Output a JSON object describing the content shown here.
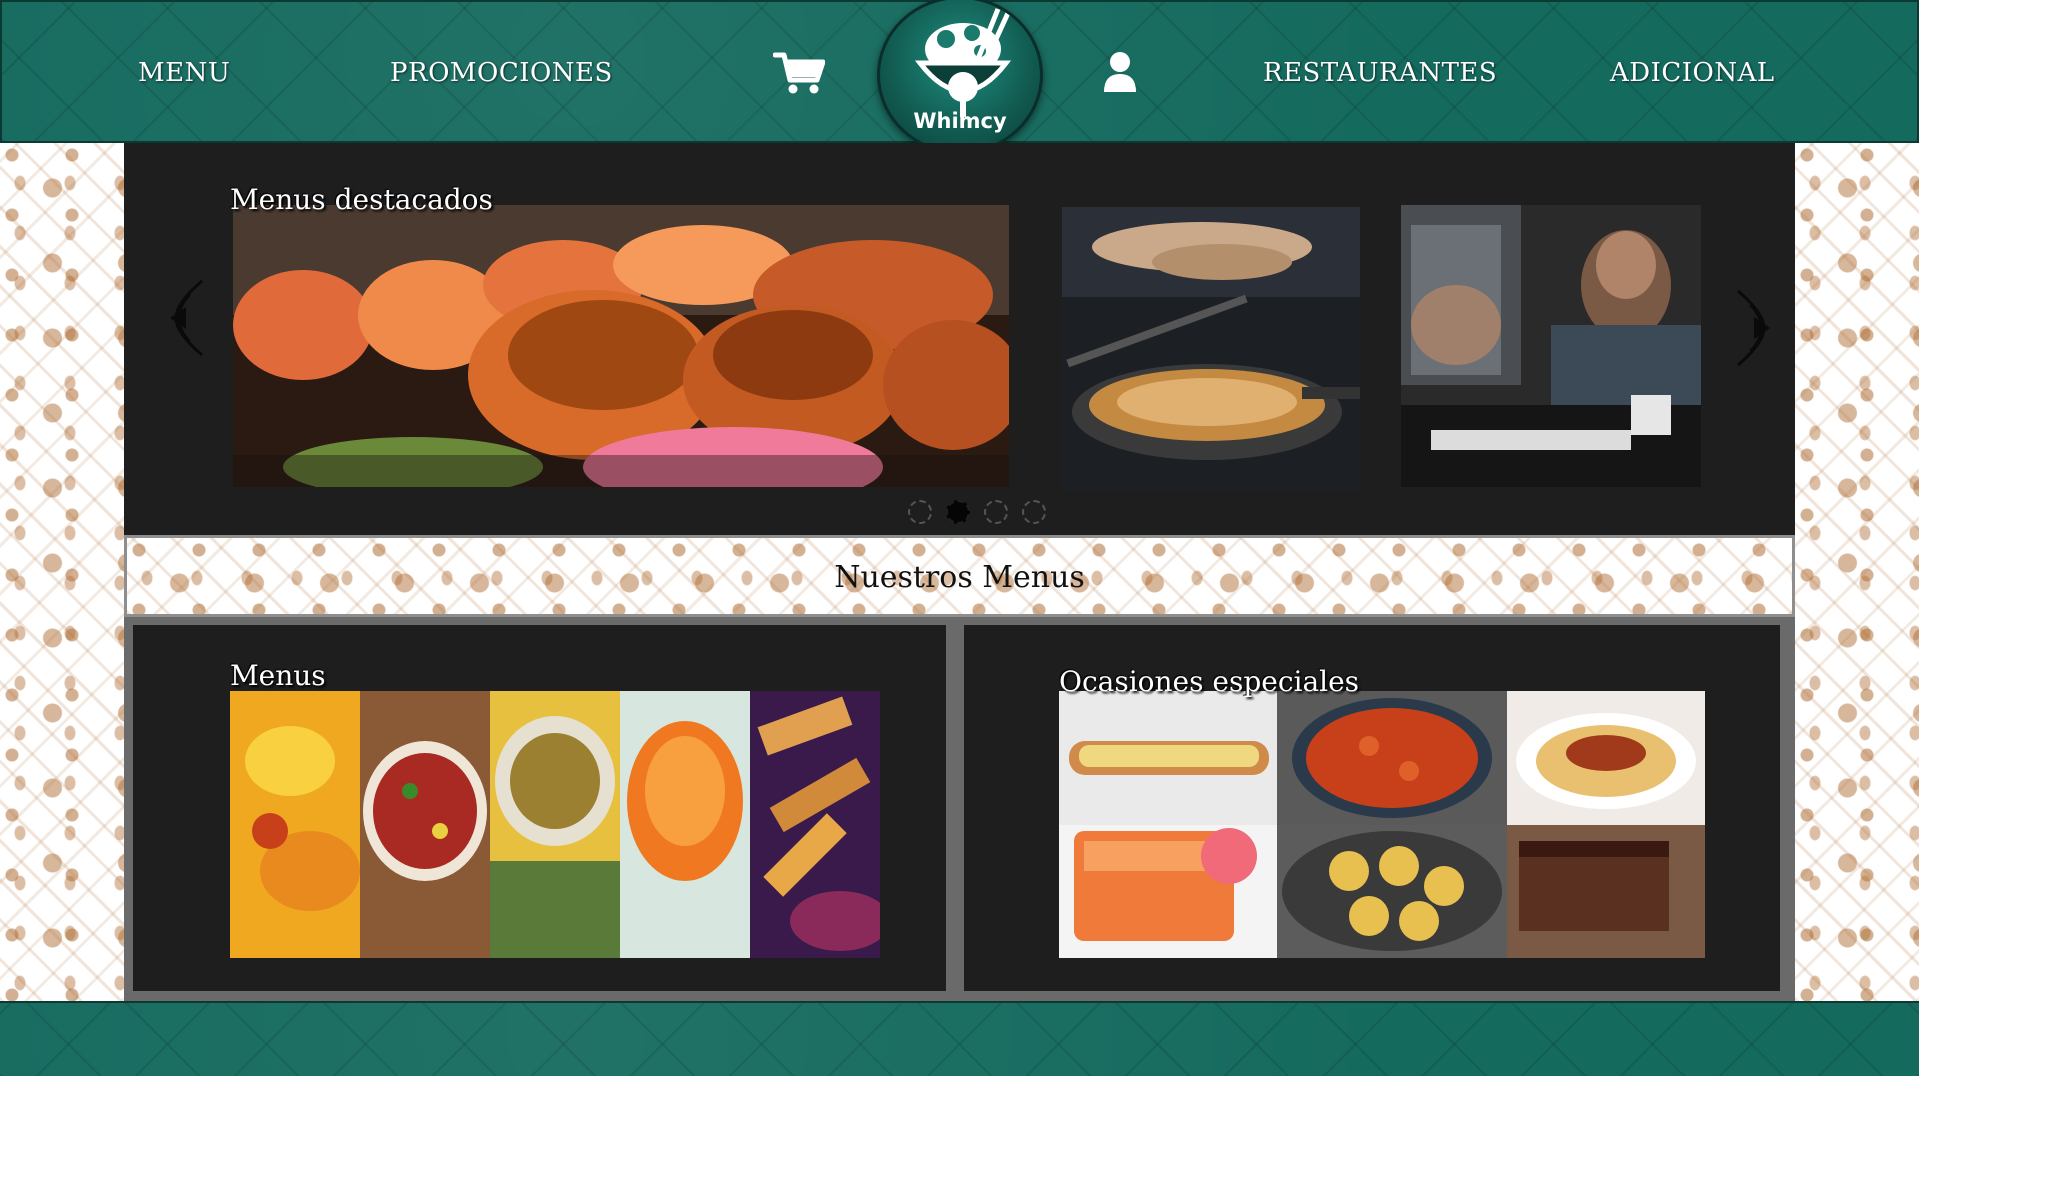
{
  "nav": {
    "menu": "MENU",
    "promociones": "PROMOCIONES",
    "restaurantes": "RESTAURANTES",
    "adicional": "ADICIONAL",
    "cart_icon": "shopping-cart-icon",
    "user_icon": "user-icon"
  },
  "logo": {
    "name": "Whimcy",
    "icon": "bowl-chef-icon"
  },
  "search": {
    "icon": "search-icon"
  },
  "featured": {
    "title": "Menus destacados",
    "slides": [
      "sushi",
      "cooking-pasta",
      "chef-kitchen"
    ],
    "active_dot": 2,
    "dot_count": 4
  },
  "section": {
    "title": "Nuestros Menus"
  },
  "cards": {
    "menus": {
      "title": "Menus",
      "images": [
        "papas",
        "frijoles",
        "ensalada",
        "zanahoria",
        "papas-fritas"
      ]
    },
    "especiales": {
      "title": "Ocasiones especiales",
      "images": [
        "hot-dog",
        "frijoles-olla",
        "espagueti",
        "salmon",
        "patacones",
        "pastel-chocolate"
      ]
    }
  },
  "colors": {
    "header_green": "#156a5e",
    "panel_dark": "#1e1e1e",
    "doodle_brown": "#b07038"
  }
}
